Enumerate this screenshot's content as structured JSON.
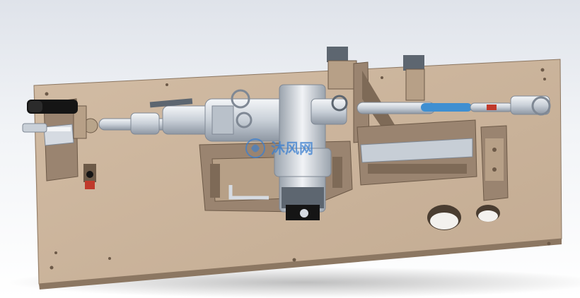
{
  "scene": {
    "description_name": "cad-fixture-render",
    "colors": {
      "plate": "#c9b39b",
      "plate_edge": "#8c7762",
      "bracket": "#9a8470",
      "metal": "#d6dbe2",
      "metal_dark": "#7f8894",
      "accent_blue": "#3f8fd1",
      "accent_red": "#c0392b",
      "black": "#151515"
    }
  },
  "watermark": {
    "text": "沐风网",
    "color": "#3a7fd0"
  }
}
